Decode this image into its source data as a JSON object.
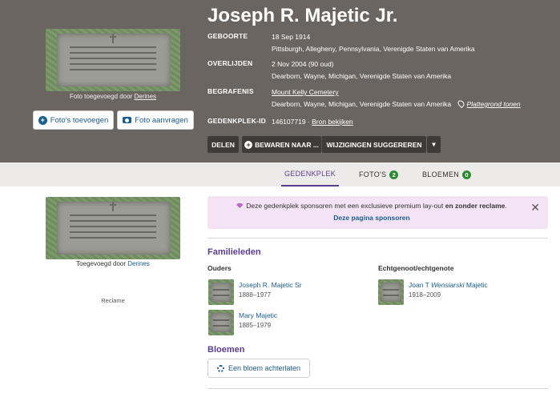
{
  "memorial": {
    "name": "Joseph R. Majetic Jr.",
    "photo_caption_prefix": "Foto toegevoegd door",
    "photo_contributor": "Derines",
    "buttons": {
      "add_photos": "Foto's toevoegen",
      "request_photo": "Foto aanvragen"
    },
    "birth": {
      "label": "GEBOORTE",
      "date": "18 Sep 1914",
      "place": "Pittsburgh, Allegheny, Pennsylvania, Verenigde Staten van Amerika"
    },
    "death": {
      "label": "OVERLIJDEN",
      "date": "2 Nov 2004 (90 oud)",
      "place": "Dearborn, Wayne, Michigan, Verenigde Staten van Amerika"
    },
    "burial": {
      "label": "BEGRAFENIS",
      "cemetery": "Mount Kelly Cemetery",
      "place": "Dearborn, Wayne, Michigan, Verenigde Staten van Amerika",
      "map_link": "Plattegrond tonen"
    },
    "memorial_id": {
      "label": "GEDENKPLEK-ID",
      "value": "146107719",
      "separator": "·",
      "source_link": "Bron bekijken"
    },
    "actions": {
      "share": "DELEN",
      "save_to": "BEWAREN NAAR ...",
      "suggest_edits": "WIJZIGINGEN SUGGEREREN",
      "more": "▾"
    }
  },
  "tabs": [
    {
      "label": "GEDENKPLEK",
      "active": true
    },
    {
      "label": "FOTO'S",
      "count": "2"
    },
    {
      "label": "BLOEMEN",
      "count": "0"
    }
  ],
  "sidebar": {
    "caption_prefix": "Toegevoegd door",
    "contributor": "Derines",
    "ad_label": "Reclame"
  },
  "sponsor": {
    "message_start": "Deze gedenkplek sponsoren met een exclusieve premium lay-out",
    "message_bold": "en zonder reclame",
    "message_end": ".",
    "link": "Deze pagina sponsoren",
    "close": "✕"
  },
  "family": {
    "title": "Familieleden",
    "parents_heading": "Ouders",
    "spouse_heading": "Echtgenoot/echtgenote",
    "parents": [
      {
        "name": "Joseph R. Majetic Sr",
        "dates": "1888–1977"
      },
      {
        "name": "Mary Majetic",
        "dates": "1885–1979"
      }
    ],
    "spouse": {
      "first": "Joan T",
      "maiden": "Wensiarski",
      "last": "Majetic",
      "dates": "1918–2009"
    }
  },
  "flowers": {
    "title": "Bloemen",
    "leave_button": "Een bloem achterlaten"
  },
  "colors": {
    "header_bg": "#6b6561",
    "accent_purple": "#5b3d8e",
    "link_blue": "#1a5d8c",
    "badge_green": "#2d8a34",
    "sponsor_bg": "#f4e3f4"
  }
}
